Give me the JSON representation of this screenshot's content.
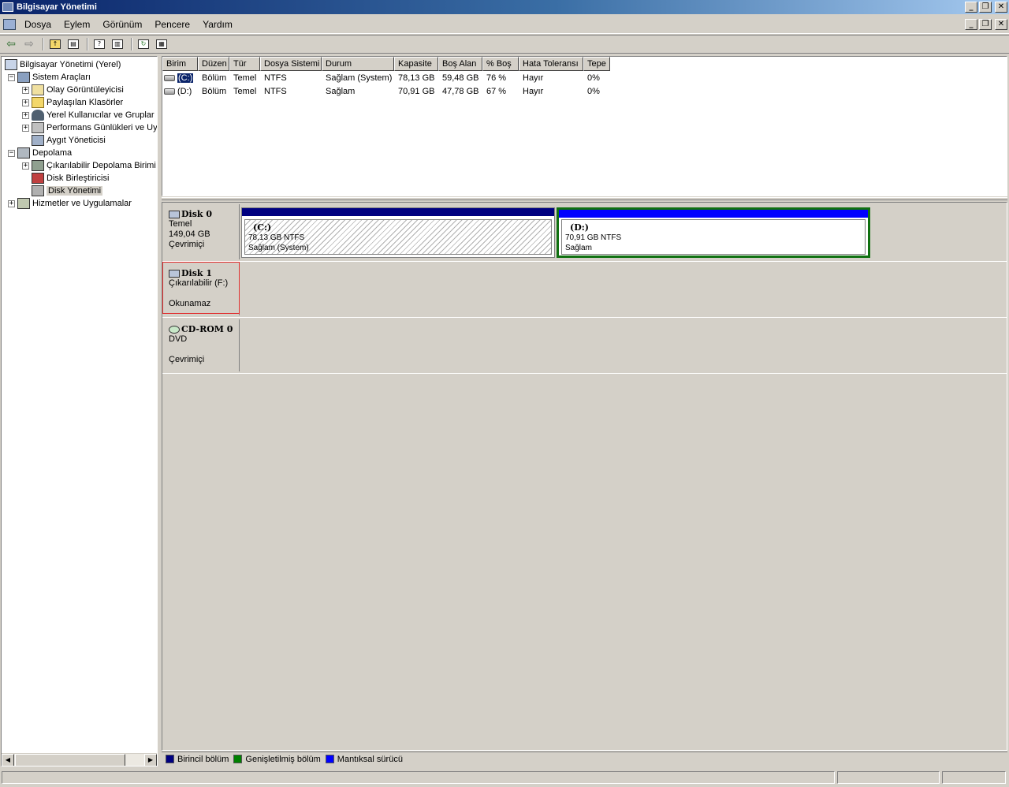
{
  "window": {
    "title": "Bilgisayar Yönetimi"
  },
  "menu": {
    "items": [
      {
        "label": "Dosya"
      },
      {
        "label": "Eylem"
      },
      {
        "label": "Görünüm"
      },
      {
        "label": "Pencere"
      },
      {
        "label": "Yardım"
      }
    ]
  },
  "toolbar": {
    "buttons": [
      "back-arrow-icon",
      "forward-arrow-icon",
      "up-folder-icon",
      "show-tree-icon",
      "properties-icon",
      "console-icon",
      "refresh-icon",
      "export-icon"
    ]
  },
  "tree": {
    "items": [
      {
        "label": "Bilgisayar Yönetimi (Yerel)"
      },
      {
        "label": "Sistem Araçları"
      },
      {
        "label": "Olay Görüntüleyicisi"
      },
      {
        "label": "Paylaşılan Klasörler"
      },
      {
        "label": "Yerel Kullanıcılar ve Gruplar"
      },
      {
        "label": "Performans Günlükleri ve Uy"
      },
      {
        "label": "Aygıt Yöneticisi"
      },
      {
        "label": "Depolama"
      },
      {
        "label": "Çıkarılabilir Depolama Birimi"
      },
      {
        "label": "Disk Birleştiricisi"
      },
      {
        "label": "Disk Yönetimi"
      },
      {
        "label": "Hizmetler ve Uygulamalar"
      }
    ]
  },
  "volume_list": {
    "columns": [
      "Birim",
      "Düzen",
      "Tür",
      "Dosya Sistemi",
      "Durum",
      "Kapasite",
      "Boş Alan",
      "% Boş",
      "Hata Toleransı",
      "Tepe"
    ],
    "rows": [
      [
        "(C:)",
        "Bölüm",
        "Temel",
        "NTFS",
        "Sağlam (System)",
        "78,13 GB",
        "59,48 GB",
        "76 %",
        "Hayır",
        "0%"
      ],
      [
        "(D:)",
        "Bölüm",
        "Temel",
        "NTFS",
        "Sağlam",
        "70,91 GB",
        "47,78 GB",
        "67 %",
        "Hayır",
        "0%"
      ]
    ]
  },
  "disks": {
    "disk0": {
      "name": "Disk 0",
      "type": "Temel",
      "size": "149,04 GB",
      "status": "Çevrimiçi",
      "partitions": [
        {
          "name": "(C:)",
          "size": "78,13 GB NTFS",
          "status": "Sağlam (System)"
        },
        {
          "name": "(D:)",
          "size": "70,91 GB NTFS",
          "status": "Sağlam"
        }
      ]
    },
    "disk1": {
      "name": "Disk 1",
      "type": "Çıkarılabilir (F:)",
      "status": "Okunamaz"
    },
    "cdrom0": {
      "name": "CD-ROM 0",
      "type": "DVD",
      "status": "Çevrimiçi"
    }
  },
  "legend": {
    "primary": "Birincil bölüm",
    "extended": "Genişletilmiş bölüm",
    "logical": "Mantıksal sürücü",
    "colors": {
      "primary": "#000080",
      "extended": "#008000",
      "logical": "#0000ff"
    }
  }
}
